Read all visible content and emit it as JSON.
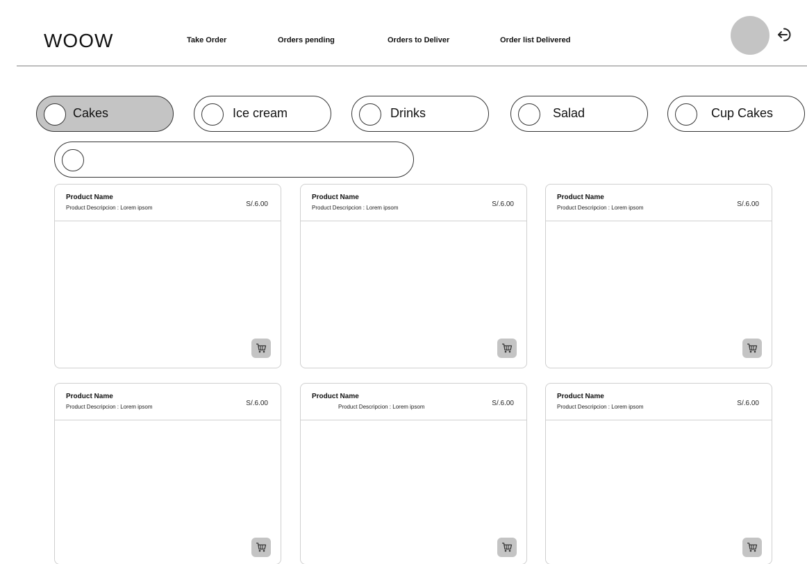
{
  "header": {
    "logo": "WOOW",
    "nav": [
      {
        "label": "Take Order"
      },
      {
        "label": "Orders pending"
      },
      {
        "label": "Orders to Deliver"
      },
      {
        "label": "Order list Delivered"
      }
    ]
  },
  "categories": [
    {
      "label": "Cakes",
      "active": true
    },
    {
      "label": "Ice cream",
      "active": false
    },
    {
      "label": "Drinks",
      "active": false
    },
    {
      "label": "Salad",
      "active": false
    },
    {
      "label": "Cup Cakes",
      "active": false
    },
    {
      "label": "",
      "active": false
    }
  ],
  "products": [
    {
      "name": "Product  Name",
      "description": "Product  Descripcion : Lorem ipsom",
      "price": "S/.6.00"
    },
    {
      "name": "Product  Name",
      "description": "Product  Descripcion : Lorem ipsom",
      "price": "S/.6.00"
    },
    {
      "name": "Product  Name",
      "description": "Product  Descripcion : Lorem ipsom",
      "price": "S/.6.00"
    },
    {
      "name": "Product  Name",
      "description": "Product  Descripcion : Lorem ipsom",
      "price": "S/.6.00"
    },
    {
      "name": "Product  Name",
      "description": "Product  Descripcion : Lorem ipsom",
      "price": "S/.6.00"
    },
    {
      "name": "Product  Name",
      "description": "Product  Descripcion : Lorem ipsom",
      "price": "S/.6.00"
    }
  ],
  "icons": {
    "logout": "logout-arrow-icon",
    "cart": "shopping-cart-icon",
    "avatar": "user-avatar"
  },
  "colors": {
    "active_chip": "#c4c4c4",
    "avatar": "#c4c4c4",
    "cart_button": "#c4c4c4",
    "divider": "#bdbdbd"
  }
}
